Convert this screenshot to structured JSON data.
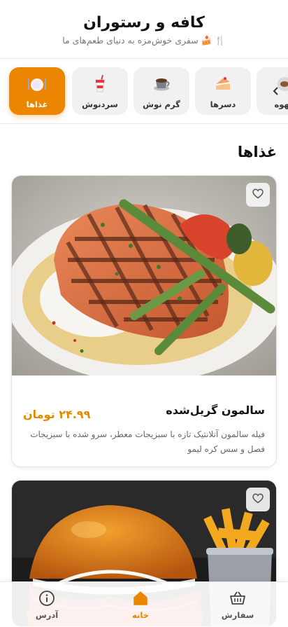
{
  "header": {
    "title": "کافه و رستوران",
    "subtitle": "🍴 🍰 سفری خوش‌مزه به دنیای طعم‌های ما"
  },
  "categories": {
    "items": [
      {
        "label": "غذاها",
        "icon": "plate-icon",
        "active": true
      },
      {
        "label": "سردنوش",
        "icon": "cold-drink-icon",
        "active": false
      },
      {
        "label": "گرم نوش",
        "icon": "coffee-cup-icon",
        "active": false
      },
      {
        "label": "دسرها",
        "icon": "cake-icon",
        "active": false
      },
      {
        "label": "قهوه",
        "icon": "coffee-icon",
        "active": false
      }
    ],
    "scroll_icon": "chevron-left-icon"
  },
  "section": {
    "title": "غذاها"
  },
  "products": [
    {
      "name": "سالمون گریل‌شده",
      "price": "۲۴.۹۹ تومان",
      "description": "فیله سالمون آتلانتیک تازه با سبزیجات معطر، سرو شده با سبزیجات فصل و سس کره لیمو",
      "favorite_icon": "heart-icon"
    },
    {
      "name": "",
      "price": "",
      "description": "",
      "favorite_icon": "heart-icon"
    }
  ],
  "bottom_nav": {
    "items": [
      {
        "label": "آدرس",
        "icon": "info-icon",
        "active": false
      },
      {
        "label": "خانه",
        "icon": "home-icon",
        "active": true
      },
      {
        "label": "سفارش",
        "icon": "basket-icon",
        "active": false
      }
    ]
  },
  "colors": {
    "accent": "#ec8500",
    "price": "#e08a00"
  }
}
